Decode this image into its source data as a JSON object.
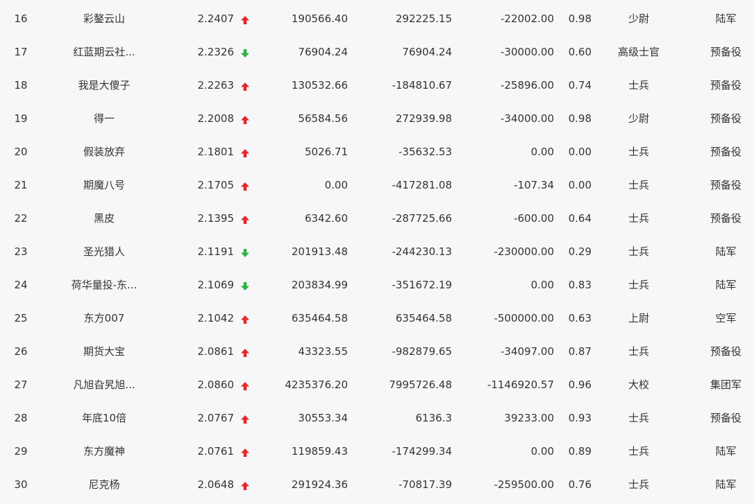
{
  "colors": {
    "up": "#e8262a",
    "down": "#2db540",
    "text": "#333333",
    "background": "#f7f7f9"
  },
  "rows": [
    {
      "rank": "16",
      "name": "彩鏊云山",
      "score": "2.2407",
      "trend": "up",
      "v1": "190566.40",
      "v2": "292225.15",
      "v3": "-22002.00",
      "ratio": "0.98",
      "rank_title": "少尉",
      "unit": "陆军"
    },
    {
      "rank": "17",
      "name": "红蓝期云社...",
      "score": "2.2326",
      "trend": "down",
      "v1": "76904.24",
      "v2": "76904.24",
      "v3": "-30000.00",
      "ratio": "0.60",
      "rank_title": "高级士官",
      "unit": "预备役"
    },
    {
      "rank": "18",
      "name": "我是大傻子",
      "score": "2.2263",
      "trend": "up",
      "v1": "130532.66",
      "v2": "-184810.67",
      "v3": "-25896.00",
      "ratio": "0.74",
      "rank_title": "士兵",
      "unit": "预备役"
    },
    {
      "rank": "19",
      "name": "得一",
      "score": "2.2008",
      "trend": "up",
      "v1": "56584.56",
      "v2": "272939.98",
      "v3": "-34000.00",
      "ratio": "0.98",
      "rank_title": "少尉",
      "unit": "预备役"
    },
    {
      "rank": "20",
      "name": "假装放弃",
      "score": "2.1801",
      "trend": "up",
      "v1": "5026.71",
      "v2": "-35632.53",
      "v3": "0.00",
      "ratio": "0.00",
      "rank_title": "士兵",
      "unit": "预备役"
    },
    {
      "rank": "21",
      "name": "期魔八号",
      "score": "2.1705",
      "trend": "up",
      "v1": "0.00",
      "v2": "-417281.08",
      "v3": "-107.34",
      "ratio": "0.00",
      "rank_title": "士兵",
      "unit": "预备役"
    },
    {
      "rank": "22",
      "name": "黑皮",
      "score": "2.1395",
      "trend": "up",
      "v1": "6342.60",
      "v2": "-287725.66",
      "v3": "-600.00",
      "ratio": "0.64",
      "rank_title": "士兵",
      "unit": "预备役"
    },
    {
      "rank": "23",
      "name": "圣光猎人",
      "score": "2.1191",
      "trend": "down",
      "v1": "201913.48",
      "v2": "-244230.13",
      "v3": "-230000.00",
      "ratio": "0.29",
      "rank_title": "士兵",
      "unit": "陆军"
    },
    {
      "rank": "24",
      "name": "荷华量投-东...",
      "score": "2.1069",
      "trend": "down",
      "v1": "203834.99",
      "v2": "-351672.19",
      "v3": "0.00",
      "ratio": "0.83",
      "rank_title": "士兵",
      "unit": "陆军"
    },
    {
      "rank": "25",
      "name": "东方007",
      "score": "2.1042",
      "trend": "up",
      "v1": "635464.58",
      "v2": "635464.58",
      "v3": "-500000.00",
      "ratio": "0.63",
      "rank_title": "上尉",
      "unit": "空军"
    },
    {
      "rank": "26",
      "name": "期货大宝",
      "score": "2.0861",
      "trend": "up",
      "v1": "43323.55",
      "v2": "-982879.65",
      "v3": "-34097.00",
      "ratio": "0.87",
      "rank_title": "士兵",
      "unit": "预备役"
    },
    {
      "rank": "27",
      "name": "凡旭旮旯旭...",
      "score": "2.0860",
      "trend": "up",
      "v1": "4235376.20",
      "v2": "7995726.48",
      "v3": "-1146920.57",
      "ratio": "0.96",
      "rank_title": "大校",
      "unit": "集团军"
    },
    {
      "rank": "28",
      "name": "年底10倍",
      "score": "2.0767",
      "trend": "up",
      "v1": "30553.34",
      "v2": "6136.3",
      "v3": "39233.00",
      "ratio": "0.93",
      "rank_title": "士兵",
      "unit": "预备役"
    },
    {
      "rank": "29",
      "name": "东方魔神",
      "score": "2.0761",
      "trend": "up",
      "v1": "119859.43",
      "v2": "-174299.34",
      "v3": "0.00",
      "ratio": "0.89",
      "rank_title": "士兵",
      "unit": "陆军"
    },
    {
      "rank": "30",
      "name": "尼克杨",
      "score": "2.0648",
      "trend": "up",
      "v1": "291924.36",
      "v2": "-70817.39",
      "v3": "-259500.00",
      "ratio": "0.76",
      "rank_title": "士兵",
      "unit": "陆军"
    }
  ]
}
